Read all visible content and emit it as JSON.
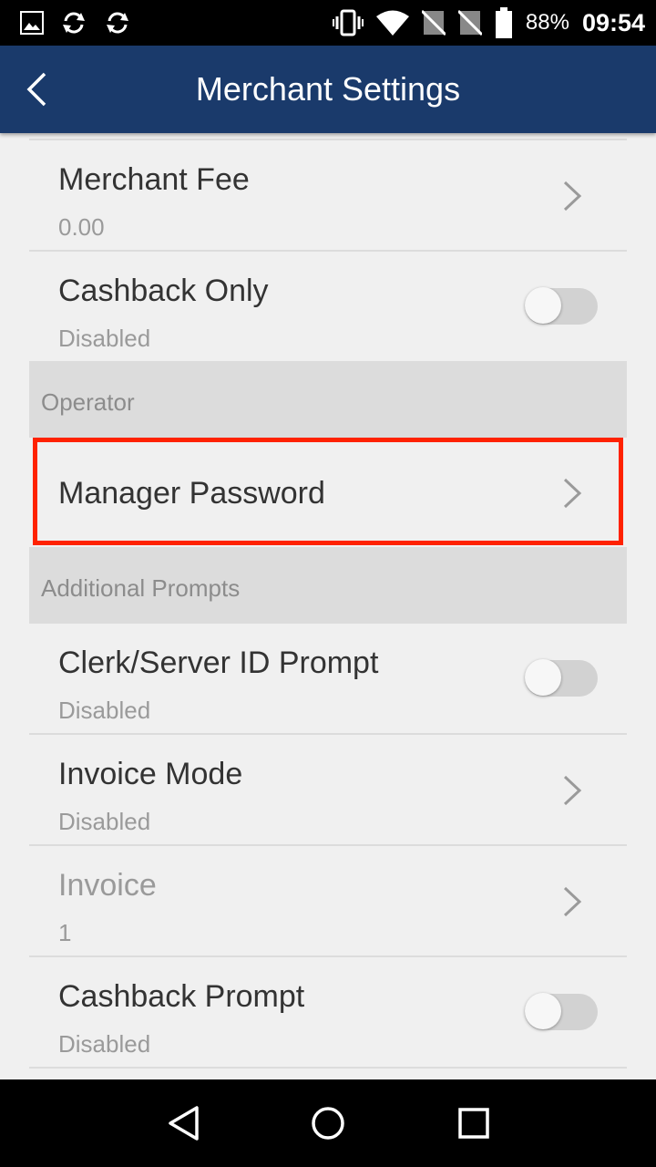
{
  "status_bar": {
    "battery": "88%",
    "time": "09:54",
    "left_icons": [
      "image-icon",
      "sync-icon",
      "sync-icon"
    ],
    "right_icons": [
      "vibrate-icon",
      "wifi-icon",
      "no-sim-icon",
      "no-sim-icon",
      "battery-icon"
    ]
  },
  "app_bar": {
    "title": "Merchant Settings",
    "back_icon": "chevron-left-icon",
    "background": "#1a3a6b"
  },
  "settings": {
    "merchant_fee": {
      "title": "Merchant Fee",
      "value": "0.00"
    },
    "cashback_only": {
      "title": "Cashback Only",
      "value": "Disabled",
      "enabled": false
    },
    "operator_header": "Operator",
    "manager_password": {
      "title": "Manager Password"
    },
    "additional_header": "Additional Prompts",
    "clerk_prompt": {
      "title": "Clerk/Server ID Prompt",
      "value": "Disabled",
      "enabled": false
    },
    "invoice_mode": {
      "title": "Invoice Mode",
      "value": "Disabled"
    },
    "invoice": {
      "title": "Invoice",
      "value": "1"
    },
    "cashback_prompt": {
      "title": "Cashback Prompt",
      "value": "Disabled",
      "enabled": false
    }
  },
  "highlight_color": "#ff2200",
  "nav_bar": {
    "buttons": [
      "back-triangle-icon",
      "home-circle-icon",
      "recents-square-icon"
    ]
  }
}
